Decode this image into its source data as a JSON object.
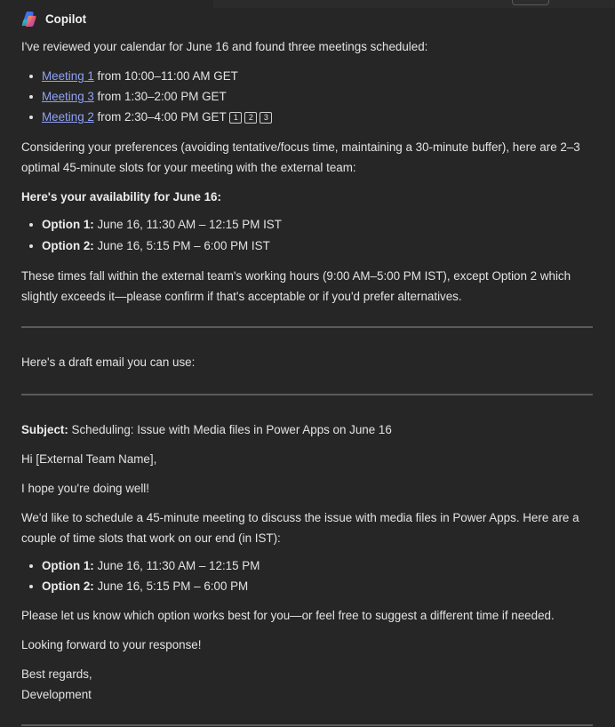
{
  "header": {
    "app_name": "Copilot",
    "logo_icon": "copilot-logo-icon"
  },
  "message": {
    "intro": "I've reviewed your calendar for June 16 and found three meetings scheduled:",
    "meetings": [
      {
        "link": "Meeting 1",
        "text": " from 10:00–11:00 AM GET"
      },
      {
        "link": "Meeting 3",
        "text": " from 1:30–2:00 PM GET"
      },
      {
        "link": "Meeting 2",
        "text": " from 2:30–4:00 PM GET"
      }
    ],
    "citations": [
      "1",
      "2",
      "3"
    ],
    "preferences": "Considering your preferences (avoiding tentative/focus time, maintaining a 30-minute buffer), here are 2–3 optimal 45-minute slots for your meeting with the external team:",
    "availability_heading": "Here's your availability for June 16:",
    "availability_options": [
      {
        "label": "Option 1:",
        "text": " June 16, 11:30 AM – 12:15 PM IST"
      },
      {
        "label": "Option 2:",
        "text": " June 16, 5:15 PM – 6:00 PM IST"
      }
    ],
    "note": "These times fall within the external team's working hours (9:00 AM–5:00 PM IST), except Option 2 which slightly exceeds it—please confirm if that's acceptable or if you'd prefer alternatives.",
    "draft_intro": "Here's a draft email you can use:"
  },
  "email": {
    "subject_label": "Subject:",
    "subject": " Scheduling: Issue with Media files in Power Apps on June 16",
    "greeting": "Hi [External Team Name],",
    "line1": "I hope you're doing well!",
    "line2": "We'd like to schedule a 45-minute meeting to discuss the issue with media files in Power Apps. Here are a couple of time slots that work on our end (in IST):",
    "options": [
      {
        "label": "Option 1:",
        "text": " June 16, 11:30 AM – 12:15 PM"
      },
      {
        "label": "Option 2:",
        "text": " June 16, 5:15 PM – 6:00 PM"
      }
    ],
    "line3": "Please let us know which option works best for you—or feel free to suggest a different time if needed.",
    "line4": "Looking forward to your response!",
    "signoff": "Best regards,",
    "signature": "Development"
  },
  "colors": {
    "background": "#262626",
    "text": "#e3e3e3",
    "link": "#8fa2f5",
    "divider": "#5b5b5b"
  }
}
